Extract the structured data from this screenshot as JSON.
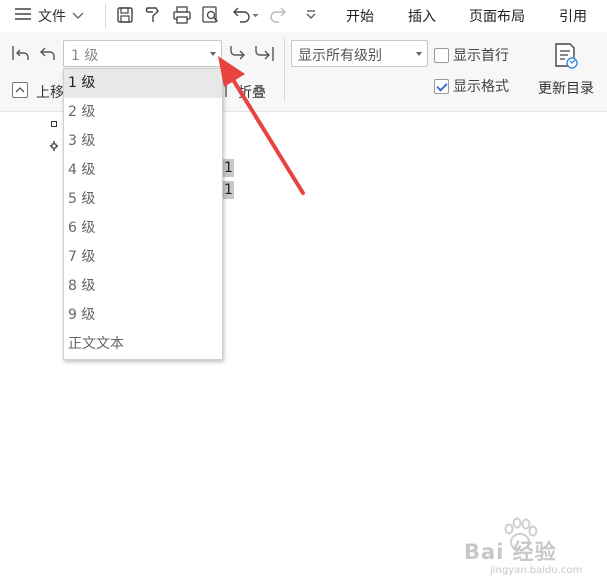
{
  "menubar": {
    "file_label": "文件",
    "tabs": [
      "开始",
      "插入",
      "页面布局",
      "引用"
    ],
    "icons": [
      "menu-icon",
      "chevron-down-icon",
      "save-icon",
      "format-painter-icon",
      "print-icon",
      "print-preview-icon",
      "undo-icon",
      "redo-icon",
      "more-icon"
    ]
  },
  "ribbon": {
    "level_select_value": "1 级",
    "show_levels_value": "显示所有级别",
    "show_first_line_label": "显示首行",
    "show_first_line_checked": false,
    "show_format_label": "显示格式",
    "show_format_checked": true,
    "update_toc_label": "更新目录",
    "move_up_label": "上移",
    "collapse_label": "折叠"
  },
  "level_dropdown": {
    "items": [
      "1 级",
      "2 级",
      "3 级",
      "4 级",
      "5 级",
      "6 级",
      "7 级",
      "8 级",
      "9 级",
      "正文文本"
    ],
    "selected_index": 0
  },
  "document": {
    "numbers": [
      "1",
      "1"
    ]
  },
  "annotation": {
    "arrow_color": "#e8433f"
  },
  "watermark": {
    "text": "Bai 经验",
    "url": "jingyan.baidu.com"
  },
  "colors": {
    "accent": "#3a6fd8",
    "selected_bg": "#e8e8e8",
    "ribbon_bg": "#f7f7f7"
  }
}
